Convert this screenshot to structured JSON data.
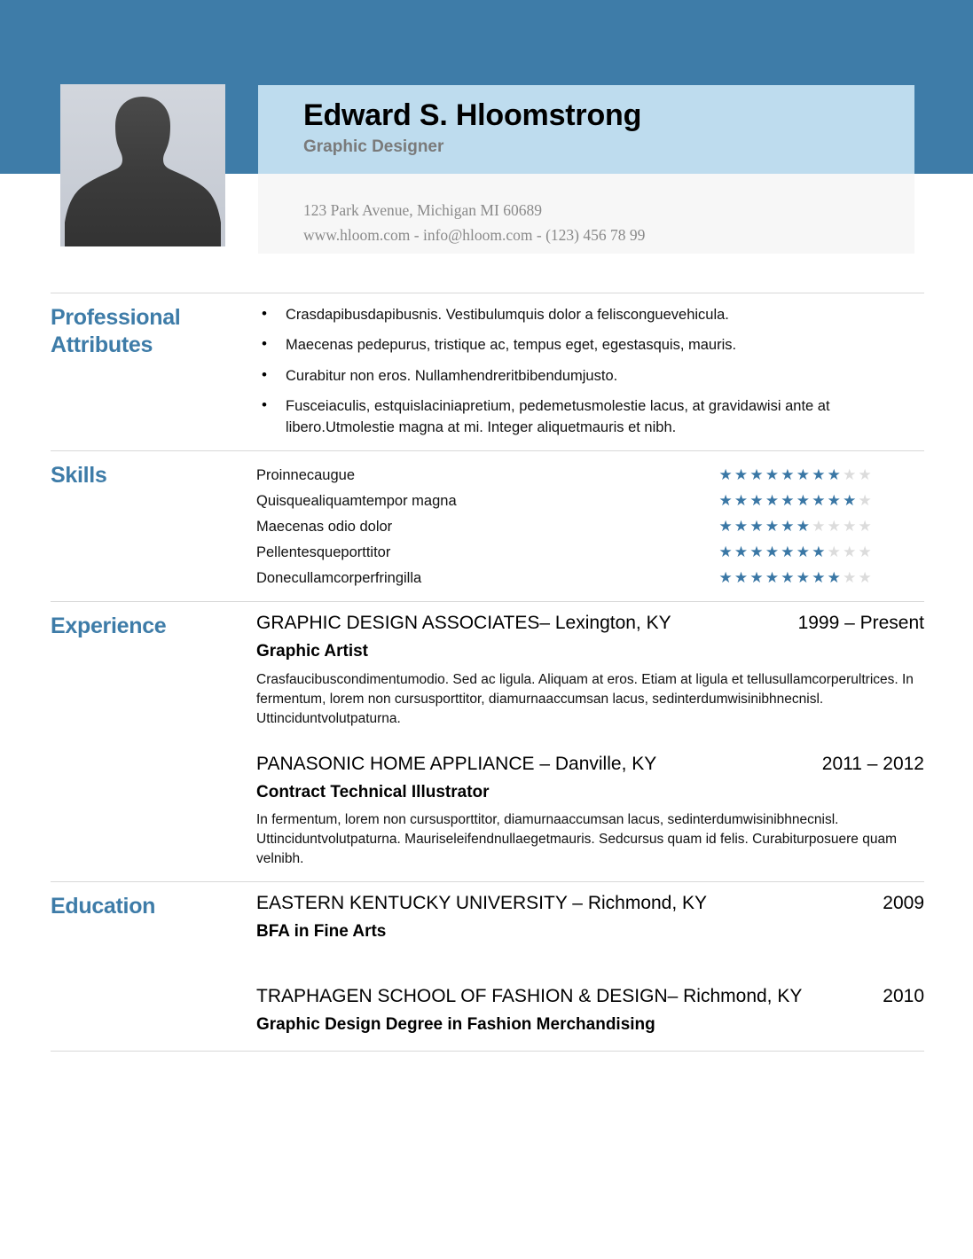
{
  "header": {
    "full_name": "Edward S. Hloomstrong",
    "job_title": "Graphic Designer",
    "photo_alt": "person-silhouette-photo",
    "contact": {
      "address": "123 Park Avenue, Michigan MI 60689",
      "links": "www.hloom.com - info@hloom.com - (123) 456 78 99"
    }
  },
  "colors": {
    "header_band": "#3e7ca8",
    "name_banner": "#bedcee",
    "contact_bg": "#f7f7f7",
    "accent": "#3e7ca8",
    "star_on": "#3a77a5",
    "star_off": "#dcdcdc",
    "rule": "#d8d8d8"
  },
  "sections": {
    "attributes": {
      "label": "Professional Attributes",
      "items": [
        "Crasdapibusdapibusnis. Vestibulumquis dolor a felisconguevehicula.",
        "Maecenas pedepurus, tristique ac, tempus eget, egestasquis, mauris.",
        "Curabitur non eros. Nullamhendreritbibendumjusto.",
        "Fusceiaculis, estquislaciniapretium, pedemetusmolestie lacus, at gravidawisi ante at libero.Utmolestie magna at mi. Integer aliquetmauris et nibh."
      ]
    },
    "skills": {
      "label": "Skills",
      "max_stars": 10,
      "items": [
        {
          "name": "Proinnecaugue",
          "rating": 8
        },
        {
          "name": "Quisquealiquamtempor magna",
          "rating": 9
        },
        {
          "name": "Maecenas odio dolor",
          "rating": 6
        },
        {
          "name": "Pellentesqueporttitor",
          "rating": 7
        },
        {
          "name": "Donecullamcorperfringilla",
          "rating": 8
        }
      ]
    },
    "experience": {
      "label": "Experience",
      "entries": [
        {
          "org": "GRAPHIC DESIGN ASSOCIATES– Lexington, KY",
          "date": "1999 – Present",
          "role": "Graphic Artist",
          "description": "Crasfaucibuscondimentumodio. Sed ac ligula. Aliquam at eros. Etiam at ligula et tellusullamcorperultrices. In fermentum, lorem non cursusporttitor, diamurnaaccumsan lacus, sedinterdumwisinibhnecnisl. Uttinciduntvolutpaturna."
        },
        {
          "org": "PANASONIC HOME APPLIANCE – Danville, KY",
          "date": "2011 – 2012",
          "role": "Contract Technical Illustrator",
          "description": "In fermentum, lorem non cursusporttitor, diamurnaaccumsan lacus, sedinterdumwisinibhnecnisl. Uttinciduntvolutpaturna. Mauriseleifendnullaegetmauris. Sedcursus quam id felis. Curabiturposuere quam velnibh."
        }
      ]
    },
    "education": {
      "label": "Education",
      "entries": [
        {
          "org": "EASTERN KENTUCKY UNIVERSITY – Richmond, KY",
          "date": "2009",
          "role": "BFA in Fine Arts",
          "description": ""
        },
        {
          "org": "TRAPHAGEN SCHOOL OF FASHION & DESIGN– Richmond, KY",
          "date": "2010",
          "role": "Graphic Design Degree in Fashion Merchandising",
          "description": ""
        }
      ]
    }
  }
}
